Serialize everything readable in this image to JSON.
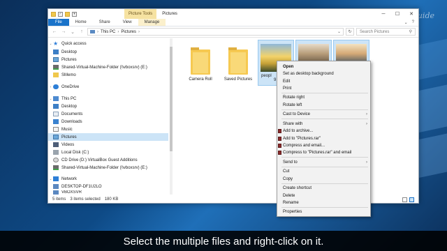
{
  "watermark": "HowToGuide",
  "window": {
    "title": "Pictures",
    "contextual_tab": "Picture Tools",
    "ribbon_tabs": [
      "File",
      "Home",
      "Share",
      "View",
      "Manage"
    ],
    "address": {
      "parts": [
        "This PC",
        "Pictures"
      ]
    },
    "search_placeholder": "Search Pictures"
  },
  "sidebar": {
    "quick_access": "Quick access",
    "qa_items": [
      "Desktop",
      "Pictures",
      "Shared-Virtual-Machine-Folder (\\\\vboxsrv) (E:)",
      "SMemo"
    ],
    "onedrive": "OneDrive",
    "this_pc": "This PC",
    "pc_items": [
      "Desktop",
      "Documents",
      "Downloads",
      "Music",
      "Pictures",
      "Videos",
      "Local Disk (C:)",
      "CD Drive (D:) VirtualBox Guest Additions",
      "Shared-Virtual-Machine-Folder (\\\\vboxsrv) (E:)"
    ],
    "network": "Network",
    "network_items": [
      "DESKTOP-DF1U2LO",
      "VBOXSVR"
    ]
  },
  "content": {
    "folders": [
      "Camera Roll",
      "Saved Pictures"
    ],
    "photo_label_partial": "peopl",
    "photo_label_partial2": "9"
  },
  "statusbar": {
    "items_count": "5 items",
    "selected": "3 items selected",
    "size": "180 KB"
  },
  "context_menu": {
    "items": [
      {
        "label": "Open",
        "bold": true
      },
      {
        "label": "Set as desktop background"
      },
      {
        "label": "Edit"
      },
      {
        "label": "Print"
      },
      {
        "label": "Rotate right"
      },
      {
        "label": "Rotate left"
      },
      {
        "label": "Cast to Device",
        "submenu": true
      },
      {
        "label": "Share with",
        "submenu": true
      },
      {
        "label": "Add to archive...",
        "icon": "winrar-icon"
      },
      {
        "label": "Add to \"Pictures.rar\"",
        "icon": "winrar-icon"
      },
      {
        "label": "Compress and email...",
        "icon": "winrar-icon"
      },
      {
        "label": "Compress to \"Pictures.rar\" and email",
        "icon": "winrar-icon"
      },
      {
        "label": "Send to",
        "submenu": true
      },
      {
        "label": "Cut"
      },
      {
        "label": "Copy"
      },
      {
        "label": "Create shortcut"
      },
      {
        "label": "Delete"
      },
      {
        "label": "Rename"
      },
      {
        "label": "Properties"
      }
    ]
  },
  "caption": "Select the multiple files and right-click on it."
}
